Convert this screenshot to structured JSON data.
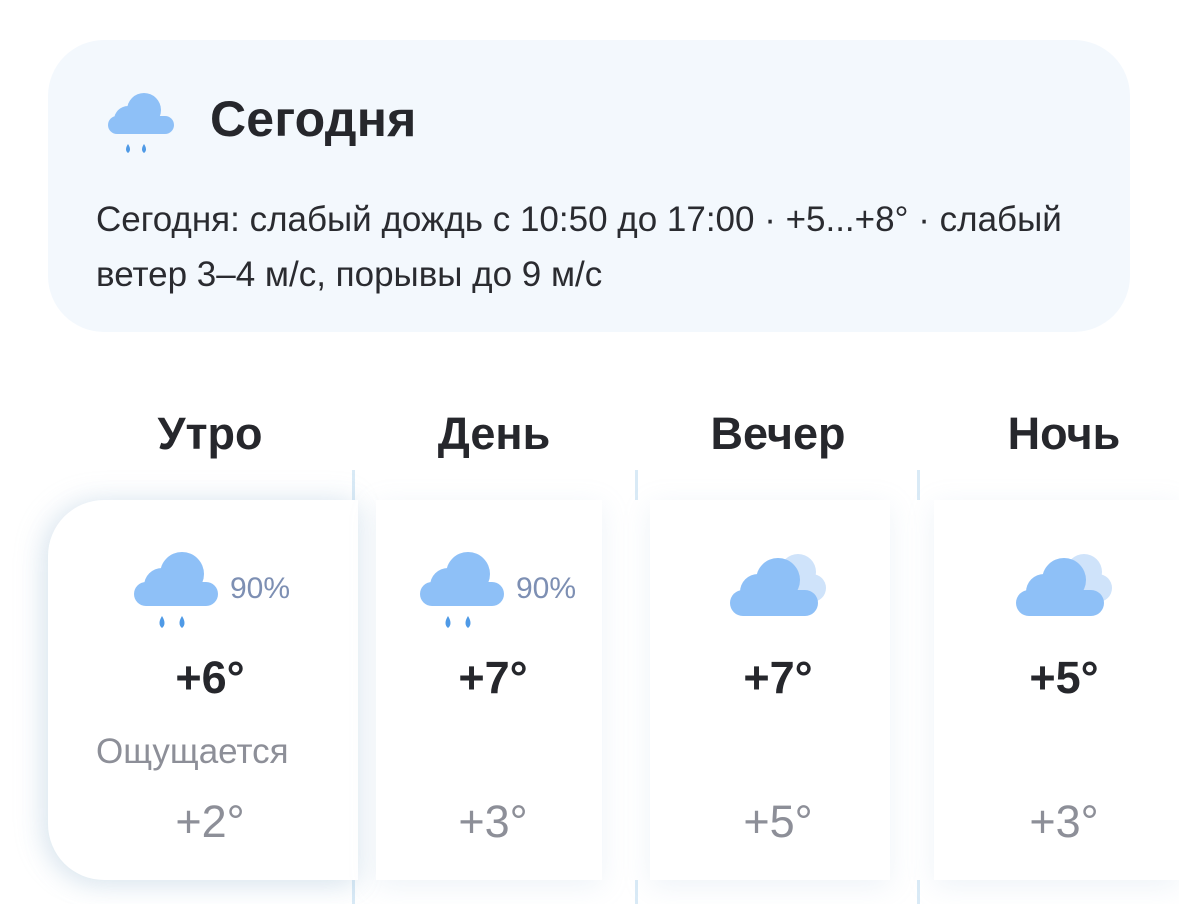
{
  "summary": {
    "title": "Сегодня",
    "icon": "rain-cloud-icon",
    "text": "Сегодня: слабый дождь с 10:50 до 17:00 · +5...+8° · слабый ветер 3–4 м/с, порывы до 9 м/с"
  },
  "feels_caption": "Ощущается",
  "periods": [
    {
      "label": "Утро",
      "icon": "rain-cloud-icon",
      "precip_prob": "90%",
      "temp": "+6°",
      "feels_like": "+2°"
    },
    {
      "label": "День",
      "icon": "rain-cloud-icon",
      "precip_prob": "90%",
      "temp": "+7°",
      "feels_like": "+3°"
    },
    {
      "label": "Вечер",
      "icon": "overcast-cloud-icon",
      "precip_prob": "",
      "temp": "+7°",
      "feels_like": "+5°"
    },
    {
      "label": "Ночь",
      "icon": "overcast-cloud-icon",
      "precip_prob": "",
      "temp": "+5°",
      "feels_like": "+3°"
    }
  ],
  "colors": {
    "card_bg": "#f3f8fd",
    "cloud": "#8ec0f7",
    "cloud_back": "#cfe3fa",
    "raindrop": "#4f9ae6",
    "prob_text": "#7d8fb3",
    "muted_text": "#8d8f98"
  }
}
